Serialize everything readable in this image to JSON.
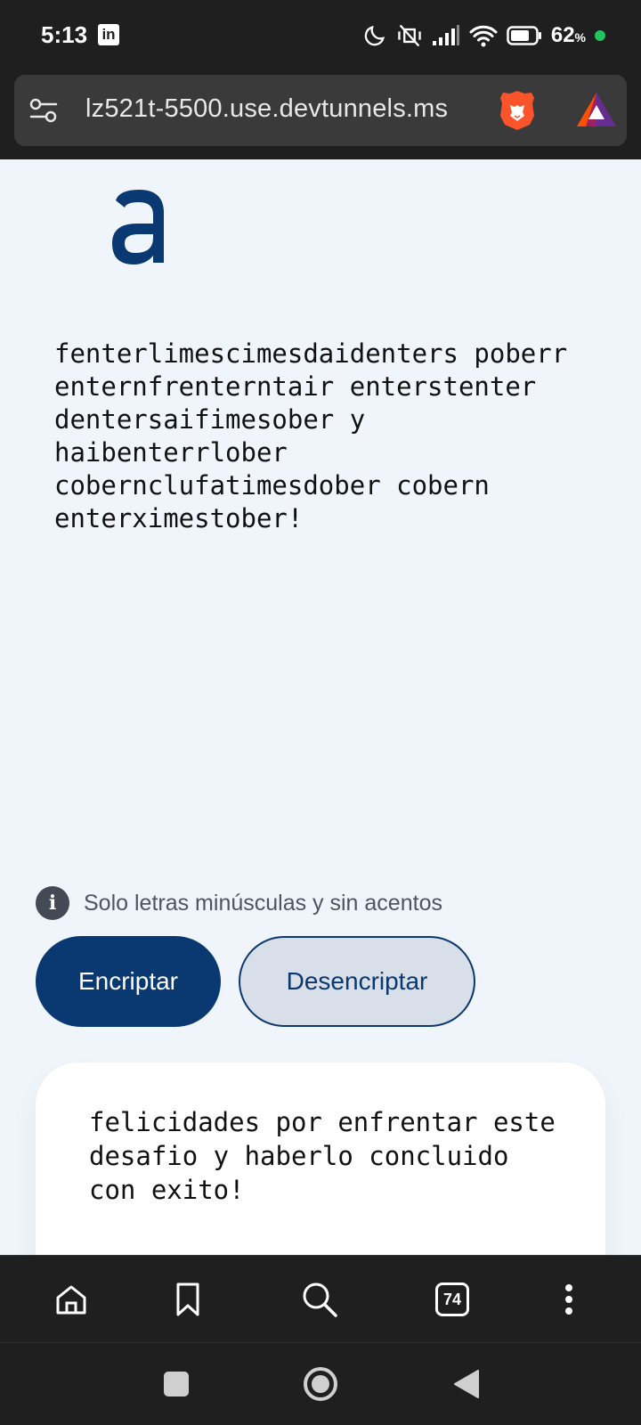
{
  "status_bar": {
    "time": "5:13",
    "notification_app": "in",
    "battery_percent": "62",
    "battery_unit": "%",
    "icons": [
      "moon-icon",
      "vibrate-off-icon",
      "signal-icon",
      "wifi-icon",
      "battery-icon"
    ]
  },
  "browser": {
    "url": "lz521t-5500.use.devtunnels.ms",
    "tab_count": "74"
  },
  "page": {
    "logo_letter": "a",
    "output_text": "fenterlimescimesdaidenters poberr enternfrenterntair enterstenter dentersaifimesober y haibenterrlober cobernclufatimesdober cobern enterximestober!",
    "info_icon": "i",
    "info_text": "Solo letras minúsculas y sin acentos",
    "encrypt_label": "Encriptar",
    "decrypt_label": "Desencriptar",
    "input_text": "felicidades por enfrentar este desafio y haberlo concluido con exito!"
  },
  "colors": {
    "primary": "#0a3871",
    "page_bg": "#f0f4fb",
    "decrypt_bg": "#d8dfe8",
    "chrome_bg": "#1f1f1f"
  }
}
